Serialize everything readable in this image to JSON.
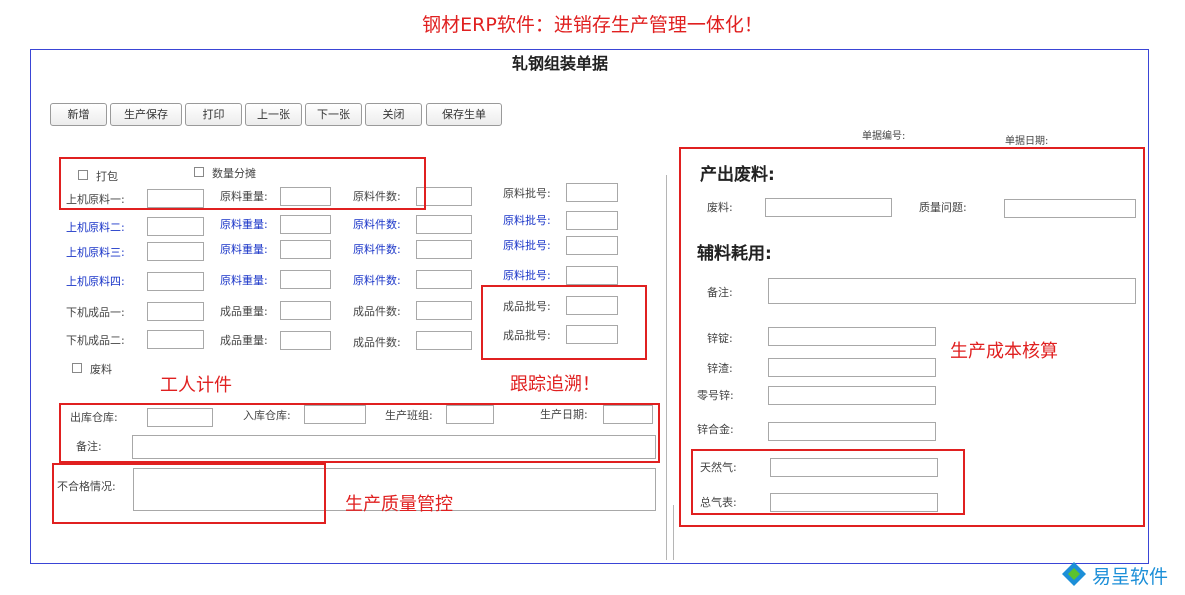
{
  "headline": "钢材ERP软件：进销存生产管理一体化！",
  "form_title": "轧钢组装单据",
  "toolbar": {
    "new": "新增",
    "save_production": "生产保存",
    "print": "打印",
    "prev": "上一张",
    "next": "下一张",
    "close": "关闭",
    "save_generate": "保存生单"
  },
  "header_fields": {
    "doc_no": "单据编号:",
    "doc_date": "单据日期:"
  },
  "left": {
    "pack": "打包",
    "qty_split": "数量分摊",
    "in1": "上机原料一:",
    "in2": "上机原料二:",
    "in3": "上机原料三:",
    "in4": "上机原料四:",
    "out1": "下机成品一:",
    "out2": "下机成品二:",
    "raw_weight": "原料重量:",
    "raw_count": "原料件数:",
    "raw_batch": "原料批号:",
    "prod_weight": "成品重量:",
    "prod_count": "成品件数:",
    "prod_batch": "成品批号:",
    "scrap": "废料",
    "out_wh": "出库仓库:",
    "in_wh": "入库仓库:",
    "team": "生产班组:",
    "prod_date": "生产日期:",
    "remark": "备注:",
    "defect": "不合格情况:"
  },
  "right": {
    "scrap_title": "产出废料:",
    "scrap": "废料:",
    "quality_issue": "质量问题:",
    "aux_title": "辅料耗用:",
    "remark": "备注:",
    "zinc_ingot": "锌锭:",
    "zinc_slag": "锌渣:",
    "zero_zinc": "零号锌:",
    "zinc_alloy": "锌合金:",
    "natural_gas": "天然气:",
    "total_gas_meter": "总气表:"
  },
  "annotations": {
    "piecework": "工人计件",
    "traceback": "跟踪追溯！",
    "quality_control": "生产质量管控",
    "cost_accounting": "生产成本核算"
  },
  "logo": {
    "text": "易呈软件"
  },
  "colors": {
    "accent_red": "#e02020",
    "frame_blue": "#3a45d6",
    "label_blue": "#1a35c8",
    "logo_blue": "#1c8fd8",
    "logo_green": "#5cc22e"
  }
}
